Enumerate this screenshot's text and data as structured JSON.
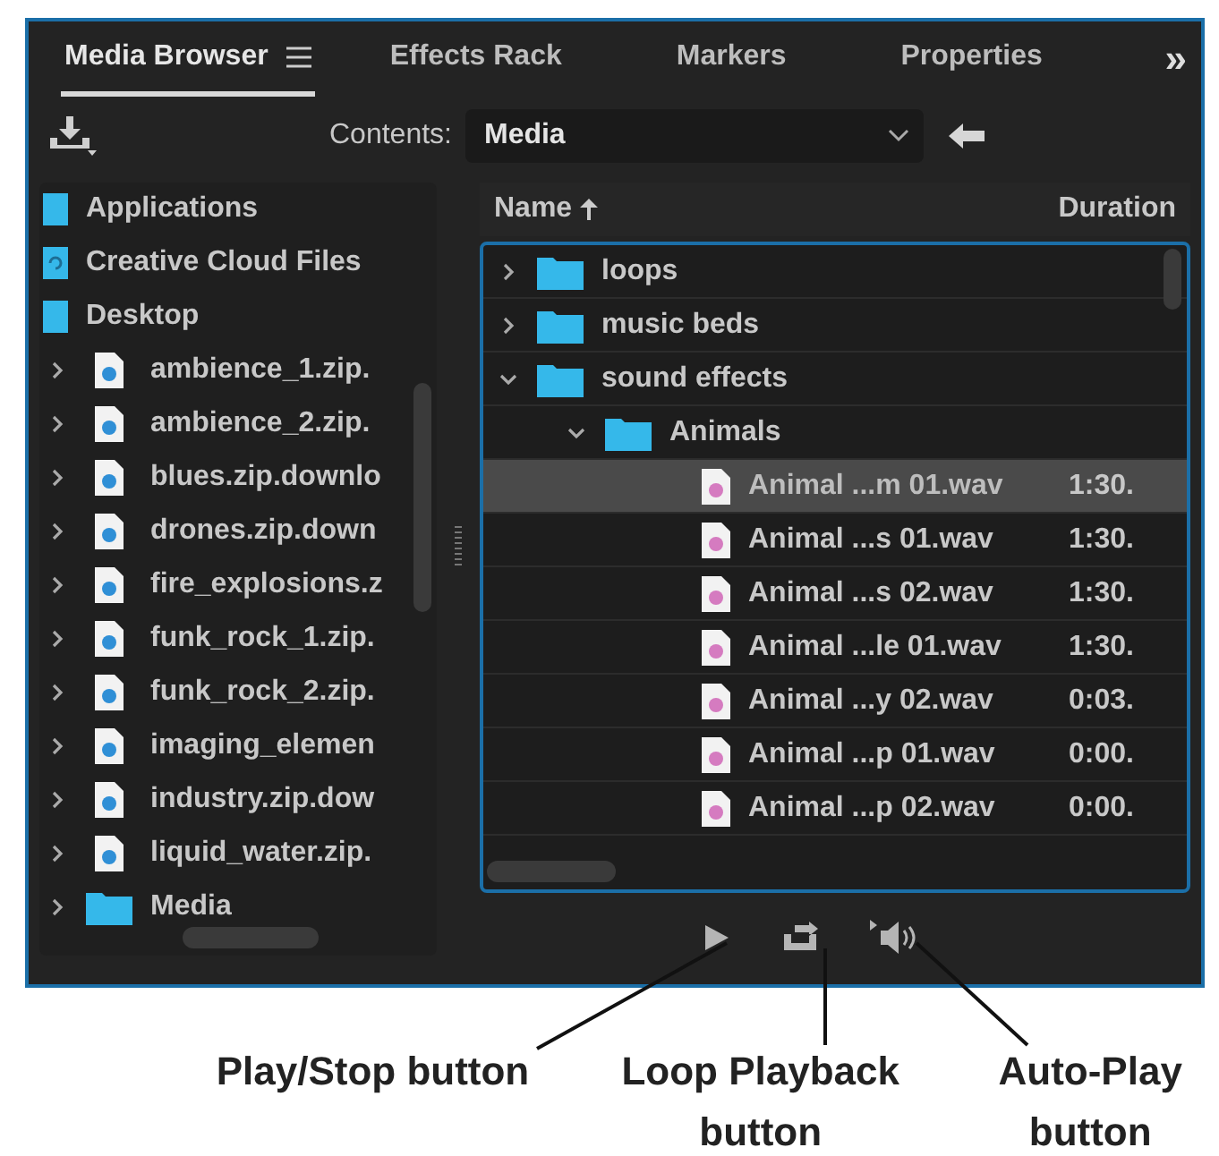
{
  "tabs": [
    {
      "label": "Media Browser",
      "selected": true
    },
    {
      "label": "Effects Rack",
      "selected": false
    },
    {
      "label": "Markers",
      "selected": false
    },
    {
      "label": "Properties",
      "selected": false
    }
  ],
  "overflow": "»",
  "toolbar": {
    "contents_label": "Contents:",
    "contents_value": "Media"
  },
  "locations": [
    {
      "label": "Applications",
      "kind": "place"
    },
    {
      "label": "Creative Cloud Files",
      "kind": "cloud"
    },
    {
      "label": "Desktop",
      "kind": "place",
      "children": [
        {
          "label": "ambience_1.zip.",
          "kind": "file",
          "expanded": false
        },
        {
          "label": "ambience_2.zip.",
          "kind": "file",
          "expanded": false
        },
        {
          "label": "blues.zip.downlo",
          "kind": "file",
          "expanded": false
        },
        {
          "label": "drones.zip.down",
          "kind": "file",
          "expanded": false
        },
        {
          "label": "fire_explosions.z",
          "kind": "file",
          "expanded": false
        },
        {
          "label": "funk_rock_1.zip.",
          "kind": "file",
          "expanded": false
        },
        {
          "label": "funk_rock_2.zip.",
          "kind": "file",
          "expanded": false
        },
        {
          "label": "imaging_elemen",
          "kind": "file",
          "expanded": false
        },
        {
          "label": "industry.zip.dow",
          "kind": "file",
          "expanded": false
        },
        {
          "label": "liquid_water.zip.",
          "kind": "file",
          "expanded": false
        },
        {
          "label": "Media",
          "kind": "folder",
          "expanded": false
        }
      ]
    }
  ],
  "columns": [
    {
      "label": "Name",
      "sorted": true
    },
    {
      "label": "Duration",
      "sorted": false
    }
  ],
  "files": [
    {
      "name": "loops",
      "kind": "folder",
      "expanded": false
    },
    {
      "name": "music beds",
      "kind": "folder",
      "expanded": false
    },
    {
      "name": "sound effects",
      "kind": "folder",
      "expanded": true,
      "children": [
        {
          "name": "Animals",
          "kind": "folder",
          "expanded": true,
          "children": [
            {
              "name": "Animal ...m 01.wav",
              "kind": "audio",
              "duration": "1:30.",
              "selected": true
            },
            {
              "name": "Animal ...s 01.wav",
              "kind": "audio",
              "duration": "1:30.",
              "selected": false
            },
            {
              "name": "Animal ...s 02.wav",
              "kind": "audio",
              "duration": "1:30.",
              "selected": false
            },
            {
              "name": "Animal ...le 01.wav",
              "kind": "audio",
              "duration": "1:30.",
              "selected": false
            },
            {
              "name": "Animal ...y 02.wav",
              "kind": "audio",
              "duration": "0:03.",
              "selected": false
            },
            {
              "name": "Animal ...p 01.wav",
              "kind": "audio",
              "duration": "0:00.",
              "selected": false
            },
            {
              "name": "Animal ...p 02.wav",
              "kind": "audio",
              "duration": "0:00.",
              "selected": false
            }
          ]
        }
      ]
    }
  ],
  "transport": [
    {
      "kind": "play"
    },
    {
      "kind": "loop"
    },
    {
      "kind": "autoplay"
    }
  ],
  "callouts": [
    {
      "label": "Play/Stop button"
    },
    {
      "label": "Loop Playback button"
    },
    {
      "label": "Auto-Play button"
    }
  ]
}
